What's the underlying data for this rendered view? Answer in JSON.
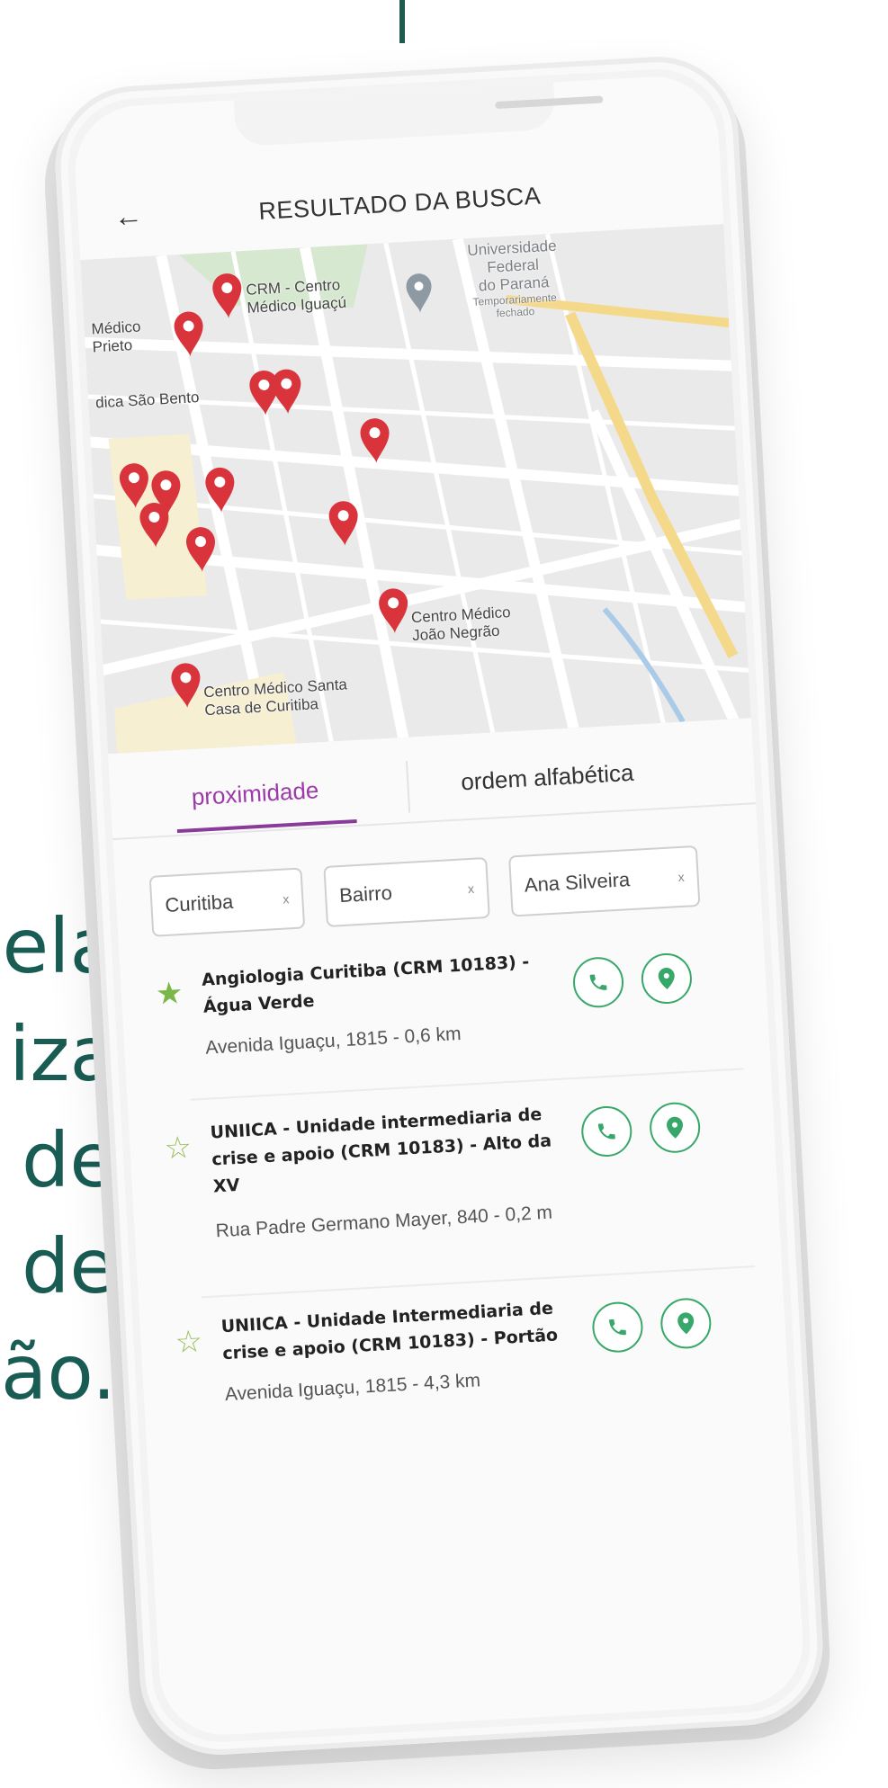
{
  "background_text": [
    "ela",
    "iza",
    "de",
    "de",
    "ão."
  ],
  "header": {
    "title": "RESULTADO DA BUSCA",
    "back_icon": "arrow-left-icon"
  },
  "map": {
    "labels": [
      {
        "name": "medico-prieto",
        "text_lines": [
          "Médico",
          "Prieto"
        ]
      },
      {
        "name": "crm-centro",
        "text_lines": [
          "CRM - Centro",
          "Médico Iguaçú"
        ]
      },
      {
        "name": "universidade",
        "text_lines": [
          "Universidade",
          "Federal",
          "do Paraná"
        ]
      },
      {
        "name": "universidade-status",
        "text_lines": [
          "Temporariamente",
          "fechado"
        ]
      },
      {
        "name": "clinica-sao-bento",
        "text_lines": [
          "dica São Bento"
        ]
      },
      {
        "name": "centro-joao-negrao",
        "text_lines": [
          "Centro Médico",
          "João Negrão"
        ]
      },
      {
        "name": "centro-santa-casa",
        "text_lines": [
          "Centro Médico Santa",
          "Casa de Curitiba"
        ]
      }
    ],
    "colors": {
      "pin": "#d9333b",
      "main_road": "#f5d98b",
      "street": "#ffffff",
      "block": "#ebeaea"
    }
  },
  "tabs": [
    {
      "label": "proximidade",
      "active": true
    },
    {
      "label": "ordem alfabética",
      "active": false
    }
  ],
  "filters": [
    {
      "label": "Curitiba",
      "close": "x"
    },
    {
      "label": "Bairro",
      "close": "x"
    },
    {
      "label": "Ana Silveira",
      "close": "x"
    }
  ],
  "results": [
    {
      "title": "Angiologia Curitiba (CRM 10183) - Água Verde",
      "address": "Avenida Iguaçu, 1815 - 0,6 km",
      "favorite": true
    },
    {
      "title": "UNIICA - Unidade intermediaria de crise e apoio (CRM 10183) - Alto da XV",
      "address": "Rua Padre Germano Mayer, 840 - 0,2 m",
      "favorite": false
    },
    {
      "title": "UNIICA - Unidade Intermediaria de crise e apoio (CRM 10183) - Portão",
      "address": "Avenida Iguaçu, 1815 - 4,3 km",
      "favorite": false
    }
  ],
  "accent_colors": {
    "purple": "#8a3b9a",
    "green": "#38a86a",
    "star": "#7ab648"
  }
}
